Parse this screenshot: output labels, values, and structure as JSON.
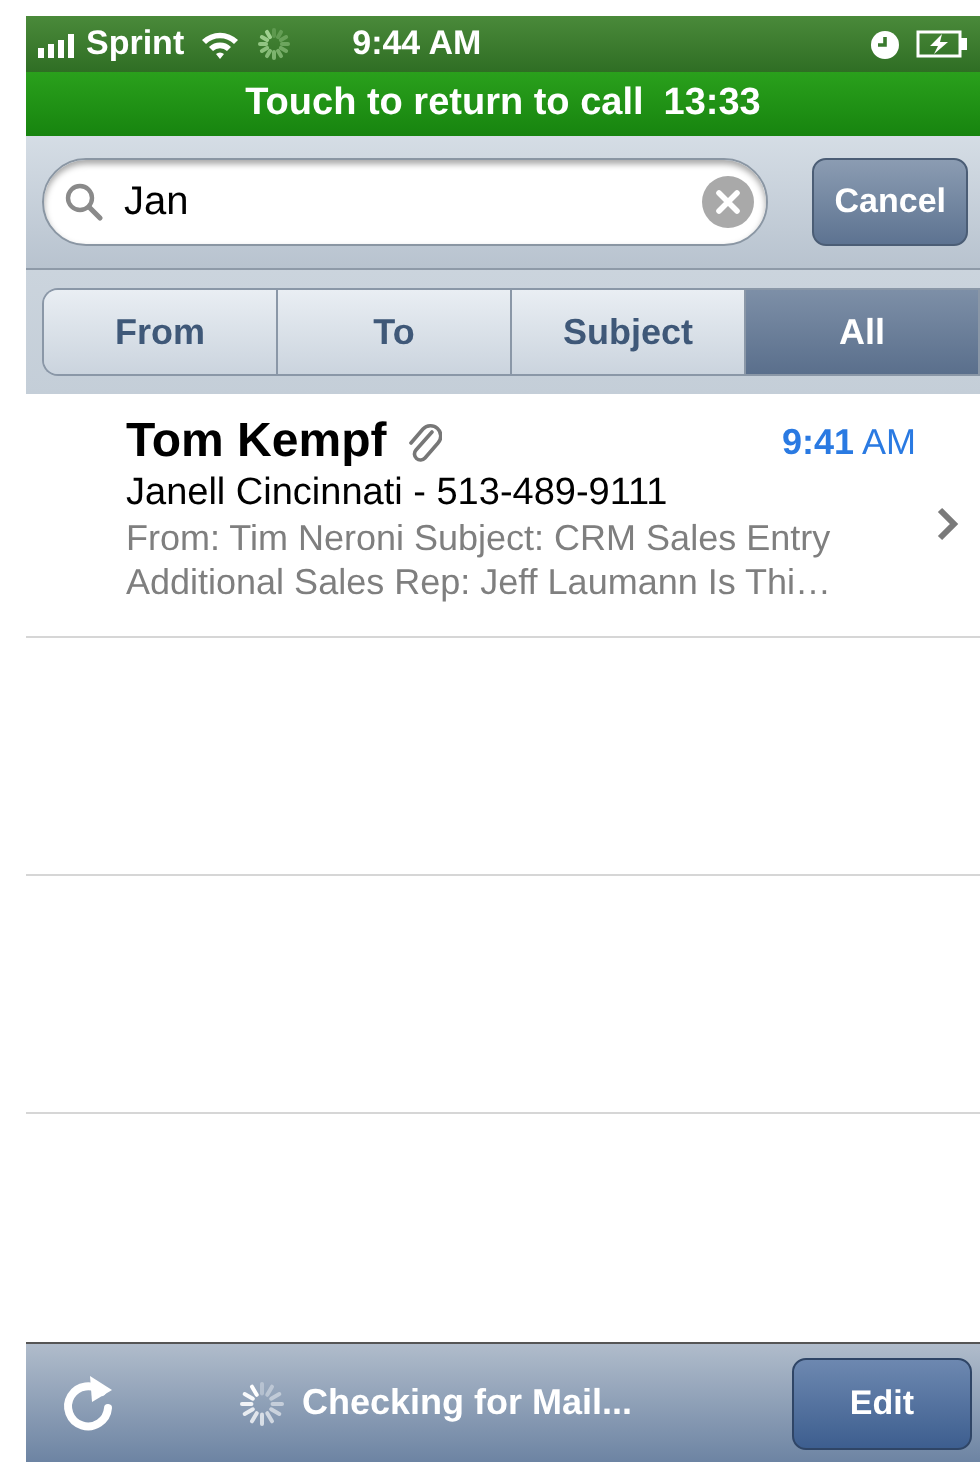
{
  "status_bar": {
    "carrier": "Sprint",
    "time": "9:44 AM"
  },
  "call_bar": {
    "text": "Touch to return to call",
    "timer": "13:33"
  },
  "search": {
    "value": "Jan",
    "cancel": "Cancel"
  },
  "scopes": [
    {
      "label": "From",
      "selected": false
    },
    {
      "label": "To",
      "selected": false
    },
    {
      "label": "Subject",
      "selected": false
    },
    {
      "label": "All",
      "selected": true
    }
  ],
  "messages": [
    {
      "sender": "Tom Kempf",
      "attachment": true,
      "time": "9:41",
      "ampm": "AM",
      "subject": "Janell Cincinnati - 513-489-9111",
      "preview": "From: Tim Neroni Subject: CRM Sales Entry Additional Sales Rep: Jeff Laumann Is Thi…"
    }
  ],
  "toolbar": {
    "status": "Checking for Mail...",
    "edit": "Edit"
  }
}
